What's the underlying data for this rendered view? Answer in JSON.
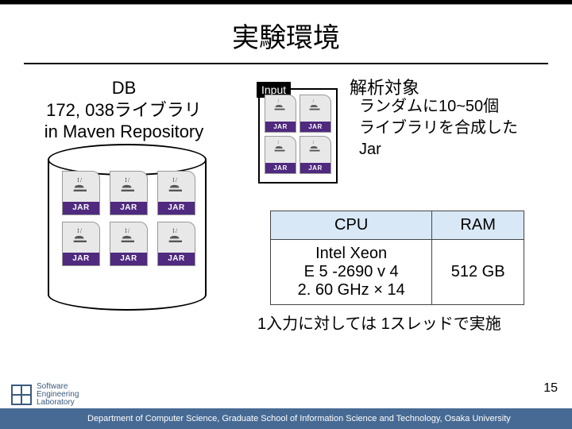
{
  "title": "実験環境",
  "db": {
    "name": "DB",
    "count_line": "172, 038ライブラリ",
    "source_line": "in Maven Repository"
  },
  "jar_band_label": "JAR",
  "input": {
    "flag": "Input",
    "target_label": "解析対象",
    "desc_line1": "ランダムに10~50個",
    "desc_line2": "ライブラリを合成した",
    "desc_line3": "Jar"
  },
  "spec": {
    "cpu_header": "CPU",
    "ram_header": "RAM",
    "cpu_line1": "Intel Xeon",
    "cpu_line2": "E 5 -2690 v 4",
    "cpu_line3": "2. 60 GHz × 14",
    "ram_value": "512 GB"
  },
  "note": "1入力に対しては 1スレッドで実施",
  "page_number": "15",
  "footer_text": "Department of Computer Science, Graduate School of Information Science and Technology, Osaka University",
  "logo": {
    "line1": "Software",
    "line2": "Engineering",
    "line3": "Laboratory"
  }
}
